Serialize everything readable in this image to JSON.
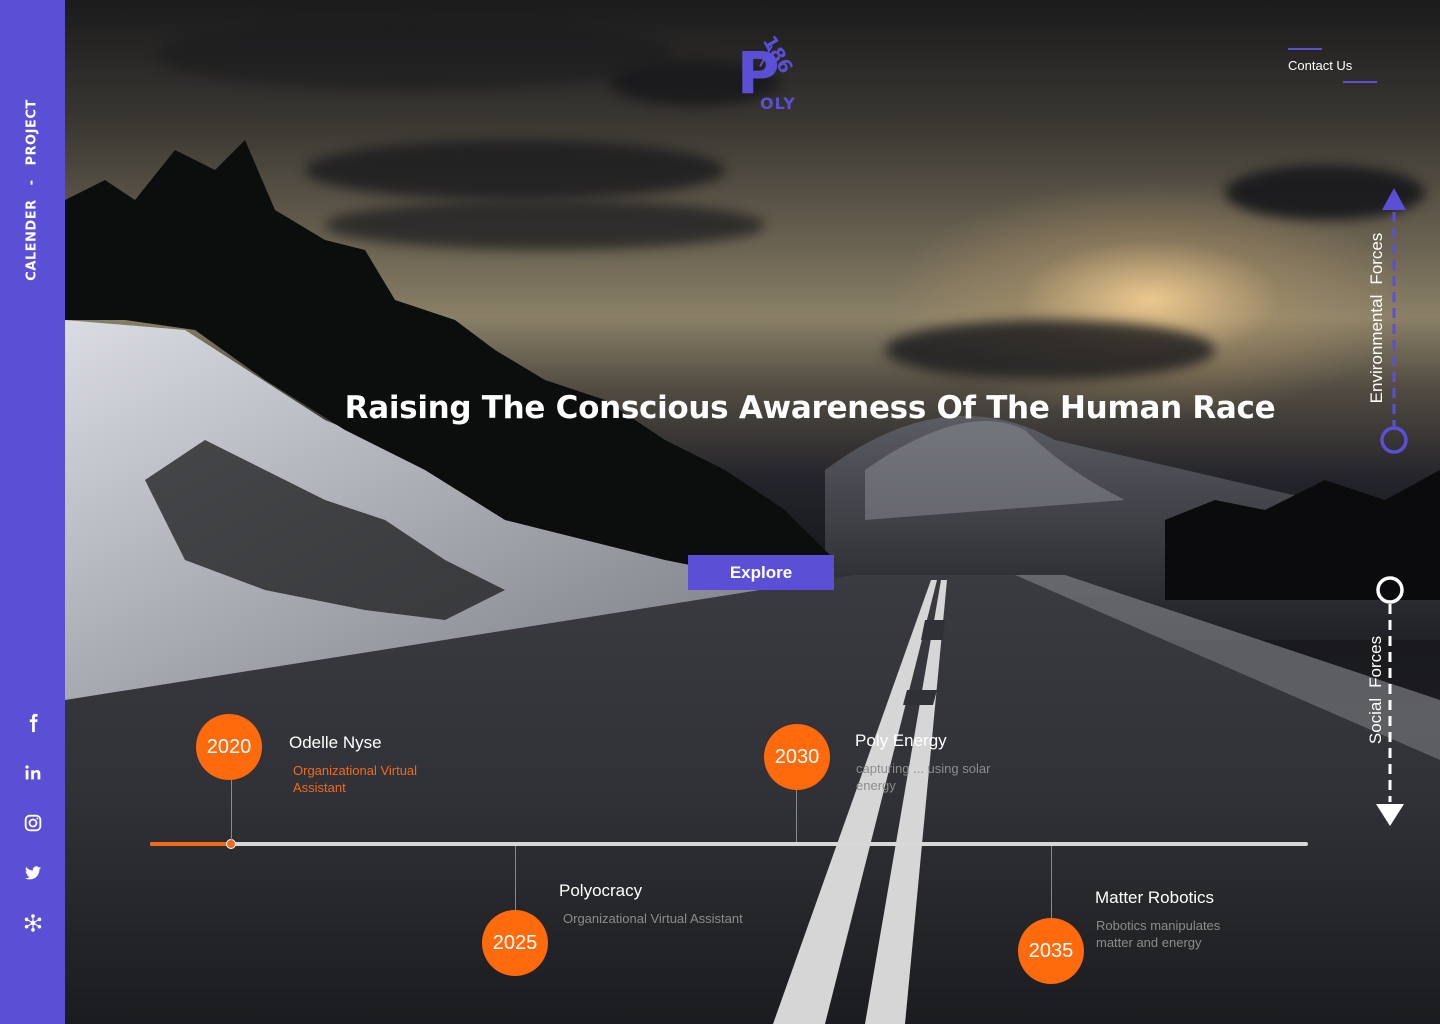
{
  "sidebar": {
    "nav": [
      "CALENDER",
      "-",
      "PROJECT"
    ],
    "social": [
      "facebook-icon",
      "linkedin-icon",
      "instagram-icon",
      "twitter-icon",
      "network-icon"
    ],
    "color": "#5b4fd6"
  },
  "logo": {
    "letter": "P",
    "suffix": "OLY",
    "number": "186"
  },
  "header": {
    "contact_label": "Contact Us"
  },
  "hero": {
    "headline": "Raising The Conscious Awareness Of The Human Race",
    "explore_label": "Explore"
  },
  "forces": {
    "environmental": [
      "Environmental",
      "Forces"
    ],
    "social": [
      "Social",
      "Forces"
    ]
  },
  "timeline": {
    "progress": 0.07,
    "events": [
      {
        "year": "2020",
        "title": "Odelle Nyse",
        "desc": "Organizational Virtual Assistant"
      },
      {
        "year": "2025",
        "title": "Polyocracy",
        "desc": "Organizational Virtual Assistant"
      },
      {
        "year": "2030",
        "title": "Poly Energy",
        "desc": "capturing ... using solar energy"
      },
      {
        "year": "2035",
        "title": "Matter Robotics",
        "desc": "Robotics manipulates matter and energy"
      }
    ]
  },
  "colors": {
    "accent": "#5b4fd6",
    "orange": "#ff6a0d",
    "track": "#d8d8d8"
  }
}
